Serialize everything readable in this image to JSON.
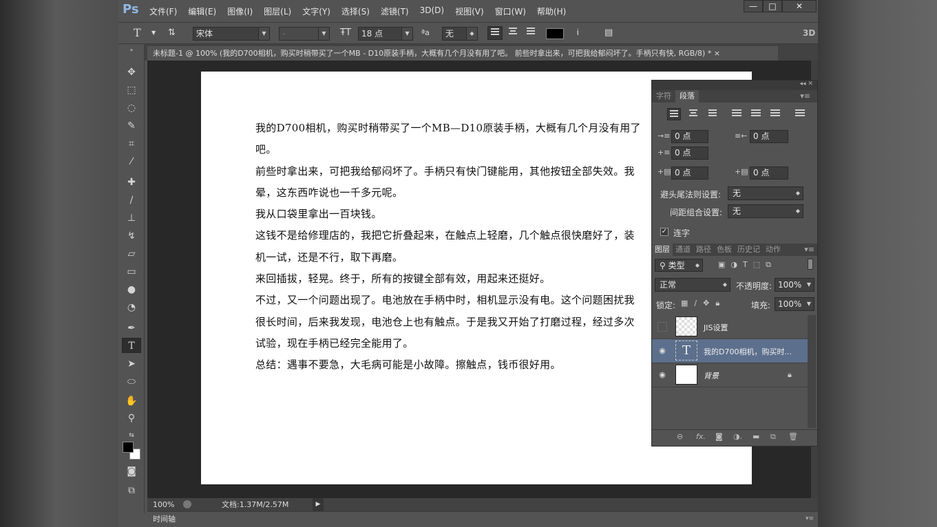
{
  "app": {
    "logo": "Ps"
  },
  "menu": [
    "文件(F)",
    "编辑(E)",
    "图像(I)",
    "图层(L)",
    "文字(Y)",
    "选择(S)",
    "滤镜(T)",
    "3D(D)",
    "视图(V)",
    "窗口(W)",
    "帮助(H)"
  ],
  "window_buttons": {
    "min": "—",
    "max": "□",
    "close": "✕"
  },
  "options": {
    "tool_glyph": "T",
    "font_family": "宋体",
    "font_style": "-",
    "size": "18 点",
    "aa_label": "ªa",
    "aa": "无",
    "mode_3d": "3D"
  },
  "doc_tab": {
    "title": "未标题-1 @ 100% (我的D700相机，购买时稍带买了一个MB - D10原装手柄，大概有几个月没有用了吧。 前些时拿出来，可把我给郁闷坏了。手柄只有快, RGB/8) *",
    "close": "×"
  },
  "document": {
    "paragraphs": [
      "我的D700相机，购买时稍带买了一个MB—D10原装手柄，大概有几个月没有用了吧。",
      "前些时拿出来，可把我给郁闷坏了。手柄只有快门键能用，其他按钮全部失效。我晕，这东西咋说也一千多元呢。",
      "我从口袋里拿出一百块钱。",
      "这钱不是给修理店的，我把它折叠起来，在触点上轻磨，几个触点很快磨好了，装机一试，还是不行，取下再磨。",
      "来回插拔，轻晃。终于，所有的按键全部有效，用起来还挺好。",
      "不过，又一个问题出现了。电池放在手柄中时，相机显示没有电。这个问题困扰我很长时间，后来我发现，电池仓上也有触点。于是我又开始了打磨过程，经过多次试验，现在手柄已经完全能用了。",
      "总结：遇事不要急，大毛病可能是小故障。擦触点，钱币很好用。"
    ]
  },
  "status": {
    "zoom": "100%",
    "doc": "文档:1.37M/2.57M"
  },
  "timeline": {
    "label": "时间轴"
  },
  "paragraph_panel": {
    "tabs": [
      "字符",
      "段落"
    ],
    "indent_left": "0 点",
    "indent_right": "0 点",
    "indent_first": "0 点",
    "space_before": "0 点",
    "space_after": "0 点",
    "kinsoku_label": "避头尾法则设置:",
    "kinsoku": "无",
    "mojikumi_label": "间距组合设置:",
    "mojikumi": "无",
    "hyphenate_label": "连字"
  },
  "layers_panel": {
    "tabs": [
      "图层",
      "通道",
      "路径",
      "色板",
      "历史记",
      "动作"
    ],
    "filter": "类型",
    "blend": "正常",
    "opacity_label": "不透明度:",
    "opacity": "100%",
    "lock_label": "锁定:",
    "fill_label": "填充:",
    "fill": "100%",
    "layers": [
      {
        "name": "JIS设置"
      },
      {
        "name": "我的D700相机，购买时..."
      },
      {
        "name": "背景"
      }
    ]
  }
}
